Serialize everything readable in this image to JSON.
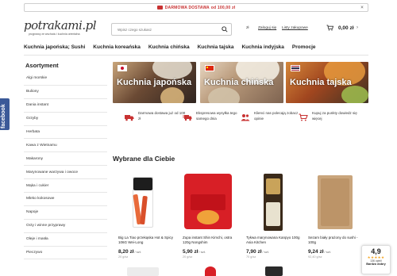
{
  "promo": {
    "text": "DARMOWA DOSTAWA",
    "threshold": "od 100,00 zł",
    "close": "×"
  },
  "logo": {
    "text": "potrakami.pl",
    "tagline": "przyprawy ze wschodu i kuchnia orientalna"
  },
  "search": {
    "placeholder": "Wpisz czego szukasz"
  },
  "header": {
    "currency": "zł",
    "login": "Zaloguj się",
    "lists": "Listy zakupowe",
    "cart_total": "0,00 zł",
    "cart_arrow": "›"
  },
  "nav": {
    "items": [
      "Kuchnia japońska; Sushi",
      "Kuchnia koreańska",
      "Kuchnia chińska",
      "Kuchnia tajska",
      "Kuchnia indyjska",
      "Promocje"
    ]
  },
  "sidebar": {
    "title": "Asortyment",
    "items": [
      "Algi morskie",
      "Buliony",
      "Dania instant",
      "Grzyby",
      "Herbata",
      "Kawa z Wietnamu",
      "Makarony",
      "Marynowane warzywa i owoce",
      "Mąka i cukier",
      "Mleko kokosowe",
      "Napoje",
      "Octy i winne przyprawy",
      "Oleje i masła",
      "Pieczywo"
    ]
  },
  "facebook": {
    "label": "facebook"
  },
  "banners": [
    {
      "title": "Kuchnia japońska"
    },
    {
      "title": "Kuchnia chińska"
    },
    {
      "title": "Kuchnia tajska"
    }
  ],
  "features": [
    {
      "text": "Darmowa dostawa już od 100 zł",
      "icon": "truck-icon"
    },
    {
      "text": "Ekspresowa wysyłka tego samego dnia",
      "icon": "lightning-truck-icon"
    },
    {
      "text": "Klienci nas polecają zobacz opinie",
      "icon": "people-icon"
    },
    {
      "text": "Kupuj za punkty dowiedz się więcej",
      "icon": "cart-points-icon"
    }
  ],
  "recommended": {
    "title": "Wybrane dla Ciebie",
    "products": [
      {
        "name": "Big La Tiao przekąska Hot & Spicy 106G Wei-Long",
        "price": "8,20 zł",
        "per": "/ szt.",
        "unit": "20 g/sz"
      },
      {
        "name": "Zupa instant Shin Kimchi, ostra 120g Nongshim",
        "price": "5,90 zł",
        "per": "/ szt.",
        "unit": "20 g/sz"
      },
      {
        "name": "Tykwa marynowana Kanpyo 100g Asia Kitchen",
        "price": "7,90 zł",
        "per": "/ szt.",
        "unit": "70 g/sz"
      },
      {
        "name": "Sezam biały prażony do sushi - 100g",
        "price": "9,24 zł",
        "per": "/ szt.",
        "unit": "92,40 g/sz"
      }
    ]
  },
  "rating": {
    "value": "4,9",
    "stars": "★★★★★",
    "count": "136 opinii",
    "label": "Bardzo dobry"
  },
  "colors": {
    "promo": "#c83232",
    "facebook": "#3b5998",
    "accent": "#c83232"
  }
}
